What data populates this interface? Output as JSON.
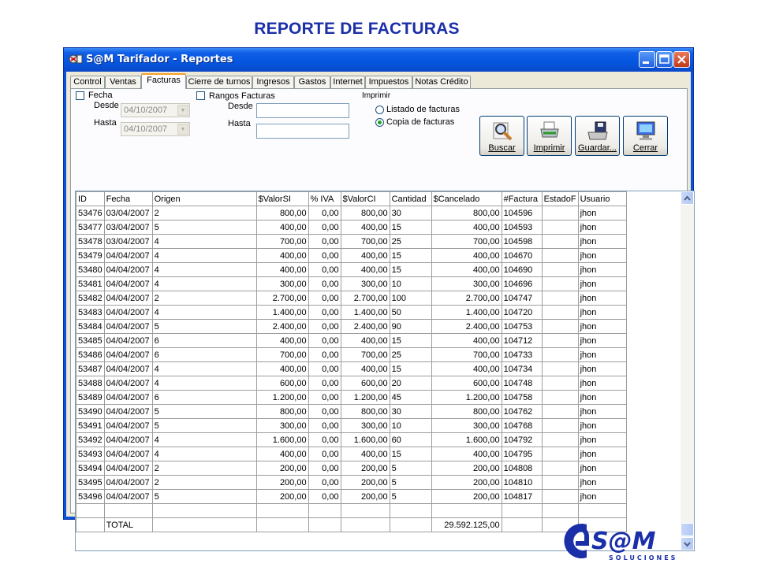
{
  "page": {
    "heading": "REPORTE DE FACTURAS"
  },
  "window": {
    "title": "S@M Tarifador - Reportes"
  },
  "tabs": [
    "Control",
    "Ventas",
    "Facturas",
    "Cierre de turnos",
    "Ingresos",
    "Gastos",
    "Internet",
    "Impuestos",
    "Notas Crédito"
  ],
  "active_tab": "Facturas",
  "filters": {
    "fecha_label": "Fecha",
    "desde_label": "Desde",
    "hasta_label": "Hasta",
    "fecha_desde": "04/10/2007",
    "fecha_hasta": "04/10/2007",
    "rangos_label": "Rangos Facturas",
    "rango_desde_label": "Desde",
    "rango_hasta_label": "Hasta",
    "rango_desde": "",
    "rango_hasta": ""
  },
  "imprimir": {
    "label": "Imprimir",
    "option_listado": "Listado de facturas",
    "option_copia": "Copia de facturas",
    "selected": "Copia de facturas"
  },
  "buttons": {
    "buscar": "Buscar",
    "imprimir": "Imprimir",
    "guardar": "Guardar...",
    "cerrar": "Cerrar"
  },
  "table": {
    "columns": [
      "ID",
      "Fecha",
      "Origen",
      "$ValorSI",
      "% IVA",
      "$ValorCI",
      "Cantidad",
      "$Cancelado",
      "#Factura",
      "EstadoF",
      "Usuario"
    ],
    "rows": [
      [
        "53476",
        "03/04/2007",
        "2",
        "800,00",
        "0,00",
        "800,00",
        "30",
        "800,00",
        "104596",
        "",
        "jhon"
      ],
      [
        "53477",
        "03/04/2007",
        "5",
        "400,00",
        "0,00",
        "400,00",
        "15",
        "400,00",
        "104593",
        "",
        "jhon"
      ],
      [
        "53478",
        "03/04/2007",
        "4",
        "700,00",
        "0,00",
        "700,00",
        "25",
        "700,00",
        "104598",
        "",
        "jhon"
      ],
      [
        "53479",
        "04/04/2007",
        "4",
        "400,00",
        "0,00",
        "400,00",
        "15",
        "400,00",
        "104670",
        "",
        "jhon"
      ],
      [
        "53480",
        "04/04/2007",
        "4",
        "400,00",
        "0,00",
        "400,00",
        "15",
        "400,00",
        "104690",
        "",
        "jhon"
      ],
      [
        "53481",
        "04/04/2007",
        "4",
        "300,00",
        "0,00",
        "300,00",
        "10",
        "300,00",
        "104696",
        "",
        "jhon"
      ],
      [
        "53482",
        "04/04/2007",
        "2",
        "2.700,00",
        "0,00",
        "2.700,00",
        "100",
        "2.700,00",
        "104747",
        "",
        "jhon"
      ],
      [
        "53483",
        "04/04/2007",
        "4",
        "1.400,00",
        "0,00",
        "1.400,00",
        "50",
        "1.400,00",
        "104720",
        "",
        "jhon"
      ],
      [
        "53484",
        "04/04/2007",
        "5",
        "2.400,00",
        "0,00",
        "2.400,00",
        "90",
        "2.400,00",
        "104753",
        "",
        "jhon"
      ],
      [
        "53485",
        "04/04/2007",
        "6",
        "400,00",
        "0,00",
        "400,00",
        "15",
        "400,00",
        "104712",
        "",
        "jhon"
      ],
      [
        "53486",
        "04/04/2007",
        "6",
        "700,00",
        "0,00",
        "700,00",
        "25",
        "700,00",
        "104733",
        "",
        "jhon"
      ],
      [
        "53487",
        "04/04/2007",
        "4",
        "400,00",
        "0,00",
        "400,00",
        "15",
        "400,00",
        "104734",
        "",
        "jhon"
      ],
      [
        "53488",
        "04/04/2007",
        "4",
        "600,00",
        "0,00",
        "600,00",
        "20",
        "600,00",
        "104748",
        "",
        "jhon"
      ],
      [
        "53489",
        "04/04/2007",
        "6",
        "1.200,00",
        "0,00",
        "1.200,00",
        "45",
        "1.200,00",
        "104758",
        "",
        "jhon"
      ],
      [
        "53490",
        "04/04/2007",
        "5",
        "800,00",
        "0,00",
        "800,00",
        "30",
        "800,00",
        "104762",
        "",
        "jhon"
      ],
      [
        "53491",
        "04/04/2007",
        "5",
        "300,00",
        "0,00",
        "300,00",
        "10",
        "300,00",
        "104768",
        "",
        "jhon"
      ],
      [
        "53492",
        "04/04/2007",
        "4",
        "1.600,00",
        "0,00",
        "1.600,00",
        "60",
        "1.600,00",
        "104792",
        "",
        "jhon"
      ],
      [
        "53493",
        "04/04/2007",
        "4",
        "400,00",
        "0,00",
        "400,00",
        "15",
        "400,00",
        "104795",
        "",
        "jhon"
      ],
      [
        "53494",
        "04/04/2007",
        "2",
        "200,00",
        "0,00",
        "200,00",
        "5",
        "200,00",
        "104808",
        "",
        "jhon"
      ],
      [
        "53495",
        "04/04/2007",
        "2",
        "200,00",
        "0,00",
        "200,00",
        "5",
        "200,00",
        "104810",
        "",
        "jhon"
      ],
      [
        "53496",
        "04/04/2007",
        "5",
        "200,00",
        "0,00",
        "200,00",
        "5",
        "200,00",
        "104817",
        "",
        "jhon"
      ]
    ],
    "total_label": "TOTAL",
    "total_value": "29.592.125,00"
  },
  "logo": {
    "text": "S@M",
    "subtitle": "SOLUCIONES"
  },
  "colors": {
    "heading": "#1b2fa8",
    "titlebar": "#0556e0",
    "logo": "#1b2fa8"
  }
}
